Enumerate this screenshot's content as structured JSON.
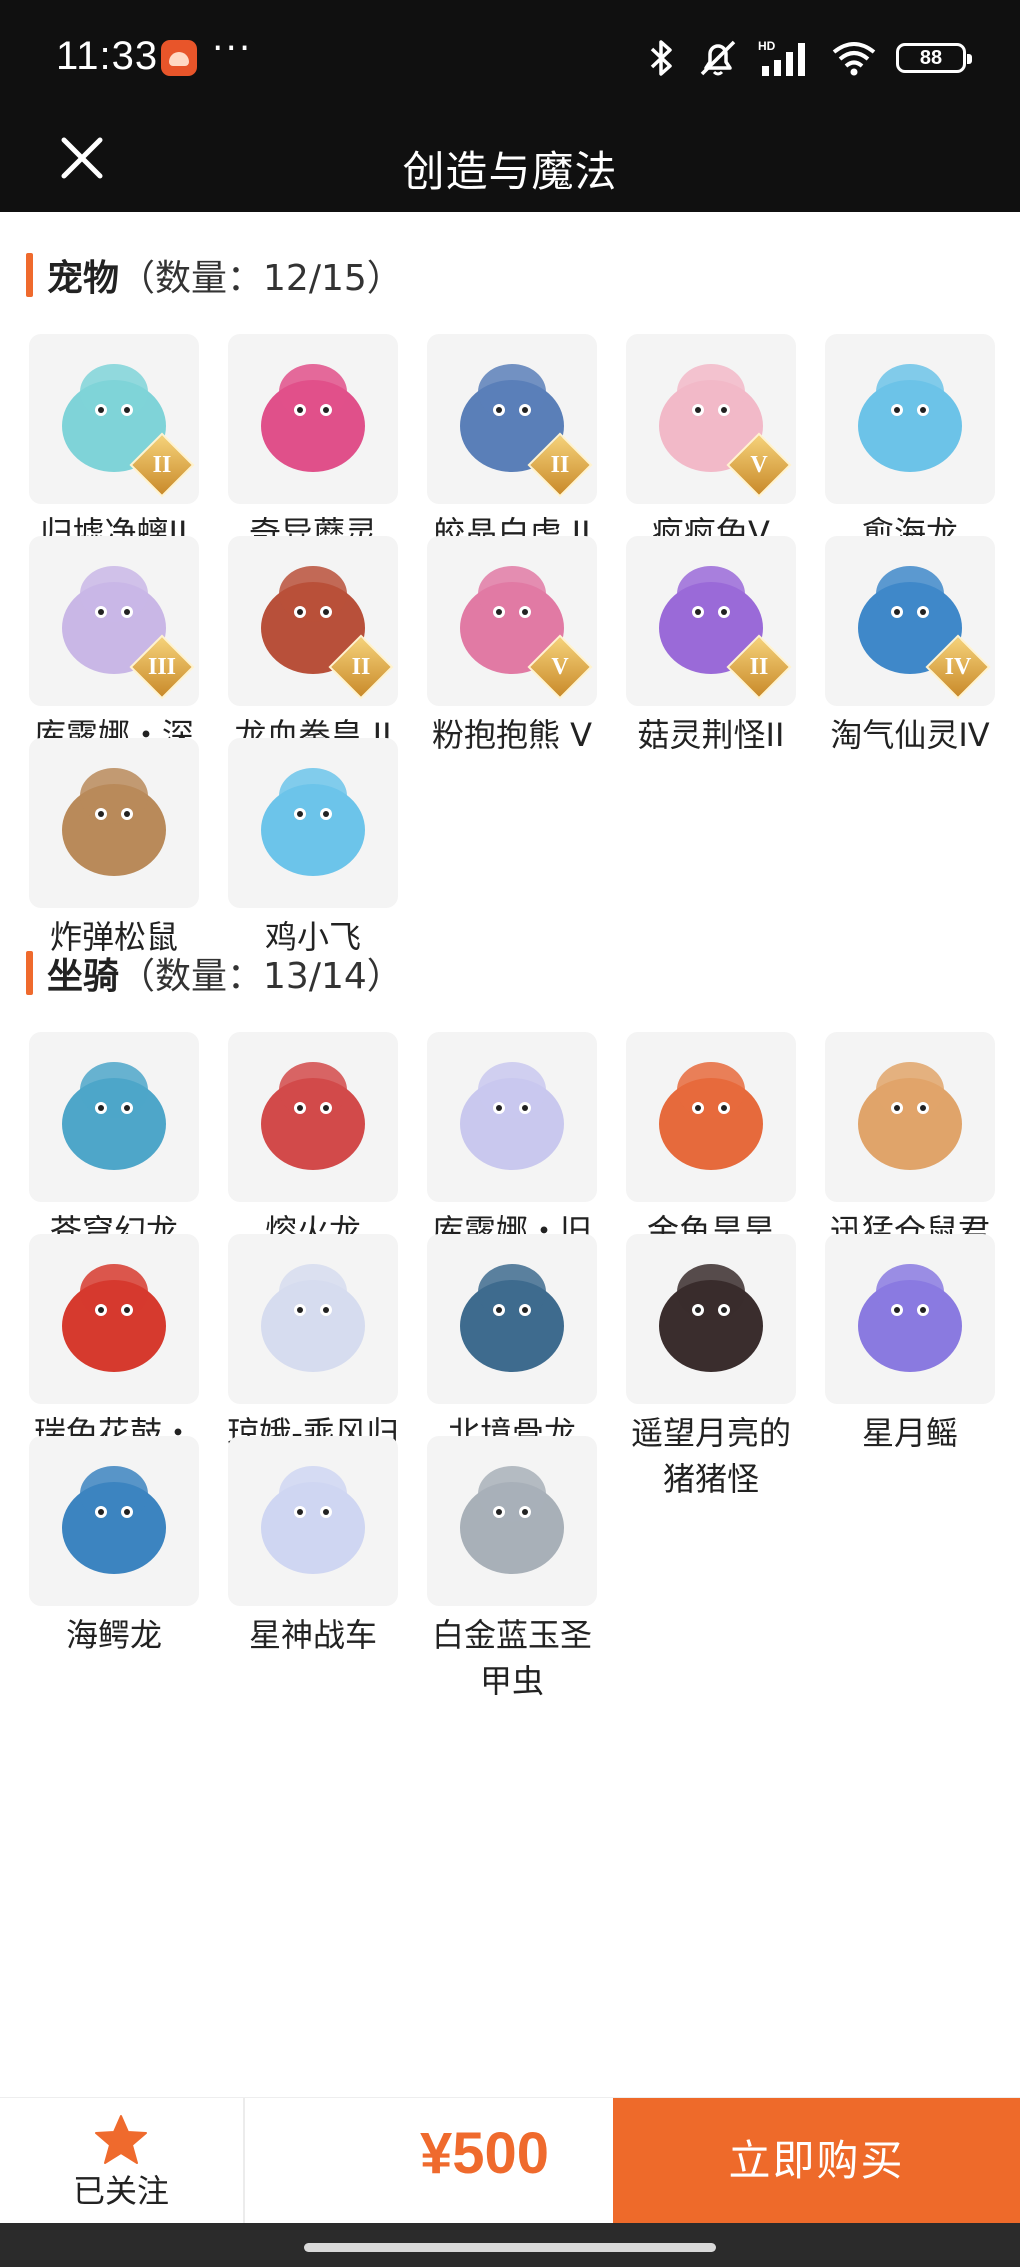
{
  "status_bar": {
    "time": "11:33",
    "more": "···",
    "battery": "88",
    "icons": [
      "app-notification-icon",
      "bluetooth-icon",
      "mute-icon",
      "hd-signal-icon",
      "wifi-icon",
      "battery-icon"
    ]
  },
  "header": {
    "title": "创造与魔法",
    "close_icon": "close-icon"
  },
  "sections": [
    {
      "name": "宠物",
      "count": "（数量：12/15）",
      "items": [
        {
          "name": "归墟净螭II",
          "rank": "II",
          "color": "#7fd3d8"
        },
        {
          "name": "奇异蘑灵",
          "rank": "",
          "color": "#e0508a"
        },
        {
          "name": "皎晶白虎 II",
          "rank": "II",
          "color": "#5a7fb8"
        },
        {
          "name": "疯疯兔V",
          "rank": "V",
          "color": "#f2b9c8"
        },
        {
          "name": "愈海龙",
          "rank": "",
          "color": "#6cc3e8"
        },
        {
          "name": "库露娜・深渊魅影III",
          "rank": "III",
          "color": "#c9b7e6"
        },
        {
          "name": "龙血拳皇 II",
          "rank": "II",
          "color": "#b8503a"
        },
        {
          "name": "粉抱抱熊 V",
          "rank": "V",
          "color": "#e17aa4"
        },
        {
          "name": "菇灵荆怪II",
          "rank": "II",
          "color": "#9a6ad8"
        },
        {
          "name": "淘气仙灵IV",
          "rank": "IV",
          "color": "#3f88c9"
        },
        {
          "name": "炸弹松鼠",
          "rank": "",
          "color": "#b98a5a"
        },
        {
          "name": "鸡小飞",
          "rank": "",
          "color": "#6cc4ea"
        }
      ]
    },
    {
      "name": "坐骑",
      "count": "（数量：13/14）",
      "items": [
        {
          "name": "苍穹幻龙",
          "rank": "",
          "color": "#4ea6c9"
        },
        {
          "name": "熔火龙",
          "rank": "",
          "color": "#d24a4a"
        },
        {
          "name": "库露娜・旧日歌者",
          "rank": "",
          "color": "#c9c8ee"
        },
        {
          "name": "金鱼昊昊",
          "rank": "",
          "color": "#e66a3c"
        },
        {
          "name": "迅猛仓鼠君",
          "rank": "",
          "color": "#e0a46a"
        },
        {
          "name": "瑞兔花鼓・春",
          "rank": "",
          "color": "#d63a2e"
        },
        {
          "name": "琼娥-乘风归",
          "rank": "",
          "color": "#d6dcef"
        },
        {
          "name": "北境骨龙",
          "rank": "",
          "color": "#3e6b8e"
        },
        {
          "name": "遥望月亮的猪猪怪",
          "rank": "",
          "color": "#3a2d2d"
        },
        {
          "name": "星月鳐",
          "rank": "",
          "color": "#8a7ae0"
        },
        {
          "name": "海鳄龙",
          "rank": "",
          "color": "#3c84c0"
        },
        {
          "name": "星神战车",
          "rank": "",
          "color": "#cfd6f2"
        },
        {
          "name": "白金蓝玉圣甲虫",
          "rank": "",
          "color": "#a8b0b8"
        }
      ]
    }
  ],
  "bottom_bar": {
    "follow_label": "已关注",
    "price": "¥500",
    "buy_label": "立即购买",
    "accent": "#ee6a2a"
  }
}
